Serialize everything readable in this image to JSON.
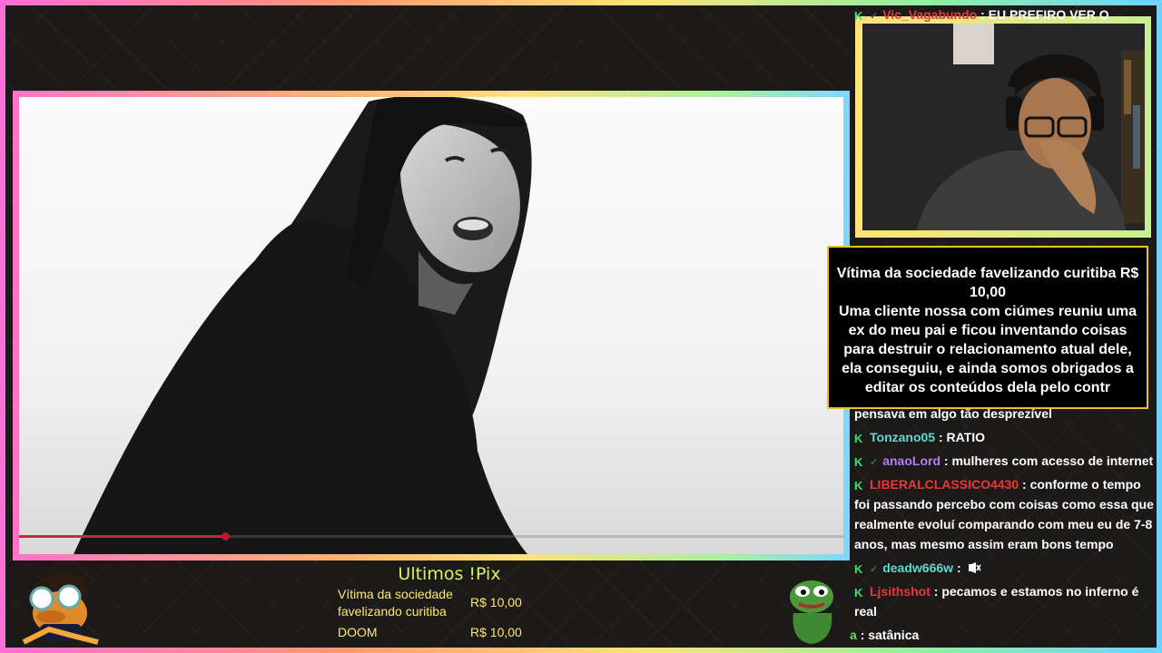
{
  "chat": {
    "messages": [
      {
        "user": "Vic_Vagabundo",
        "text": ": EU PREFIRO VER O",
        "color": "#e8383a",
        "partial": true
      },
      {
        "user": "",
        "text": "pensava em algo tão desprezível"
      },
      {
        "user": "Tonzano05",
        "text": ": RATIO",
        "color": "#5fd9d1"
      },
      {
        "user": "anaoLord",
        "text": ": mulheres com acesso de internet",
        "color": "#b67cf7"
      },
      {
        "user": "LIBERALCLASSICO4430",
        "text": ": conforme o tempo foi passando percebo com coisas como essa que realmente evoluí comparando com meu eu de 7-8 anos, mas mesmo assim eram bons tempo",
        "color": "#e8383a"
      },
      {
        "user": "deadw666w",
        "text": ":",
        "color": "#5fd9d1",
        "icon": "muted-speaker-icon"
      },
      {
        "user": "Ljsithshot",
        "text": ": pecamos e estamos no inferno é real",
        "color": "#e8383a"
      },
      {
        "user": "a",
        "text": ": satânica",
        "color": "#6ed460"
      }
    ]
  },
  "alert": {
    "line1": "Vítima da sociedade favelizando curitiba R$ 10,00",
    "message": "Uma cliente nossa com ciúmes reuniu uma ex do meu pai e ficou inventando coisas para destruir o relacionamento atual dele, ela conseguiu, e ainda somos obrigados a editar os conteúdos dela pelo contr"
  },
  "pix": {
    "title": "Ultimos !Pix",
    "entries": [
      {
        "name": "Vítima da sociedade favelizando curitiba",
        "amount": "R$ 10,00"
      },
      {
        "name": "DOOM",
        "amount": "R$ 10,00"
      }
    ]
  },
  "video": {
    "progress": 0.25
  },
  "colors": {
    "accent_gold": "#f2c21b",
    "pix_text": "#ffe86a",
    "pix_title": "#d7f25c",
    "badge_green": "#3fe06f"
  }
}
